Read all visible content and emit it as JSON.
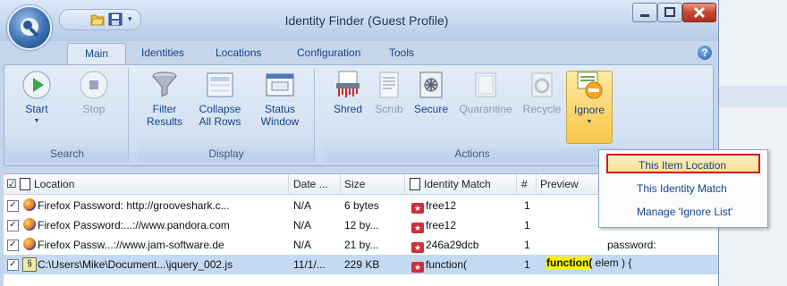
{
  "window": {
    "title": "Identity Finder (Guest Profile)"
  },
  "tabs": [
    {
      "label": "Main",
      "active": true
    },
    {
      "label": "Identities"
    },
    {
      "label": "Locations"
    },
    {
      "label": "Configuration"
    },
    {
      "label": "Tools"
    }
  ],
  "help_label": "?",
  "ribbon": {
    "groups": {
      "search": "Search",
      "display": "Display",
      "actions": "Actions"
    },
    "buttons": {
      "start": "Start",
      "stop": "Stop",
      "filter_1": "Filter",
      "filter_2": "Results",
      "collapse_1": "Collapse",
      "collapse_2": "All Rows",
      "status_1": "Status",
      "status_2": "Window",
      "shred": "Shred",
      "scrub": "Scrub",
      "secure": "Secure",
      "quarantine": "Quarantine",
      "recycle": "Recycle",
      "ignore": "Ignore"
    }
  },
  "table": {
    "columns": {
      "check": "☑",
      "location": "Location",
      "date": "Date ...",
      "size": "Size",
      "identity_match": "Identity Match",
      "count": "#",
      "preview": "Preview"
    },
    "rows": [
      {
        "location": "Firefox Password: http://grooveshark.c...",
        "date": "N/A",
        "size": "6 bytes",
        "match": "free12",
        "count": "1"
      },
      {
        "location": "Firefox Password:...://www.pandora.com",
        "date": "N/A",
        "size": "12 by...",
        "match": "free12",
        "count": "1"
      },
      {
        "location": "Firefox Passw...://www.jam-software.de",
        "date": "N/A",
        "size": "21 by...",
        "match": "246a29dcb",
        "count": "1"
      },
      {
        "location": "C:\\Users\\Mike\\Document...\\jquery_002.js",
        "date": "11/1/...",
        "size": "229 KB",
        "match": "function(",
        "count": "1"
      }
    ],
    "preview": {
      "line1": "password:",
      "highlight": "function(",
      "rest": " elem ) {"
    }
  },
  "ignore_menu": [
    {
      "label": "This Item Location",
      "active": true
    },
    {
      "label": "This Identity Match"
    },
    {
      "label": "Manage 'Ignore List'"
    }
  ]
}
